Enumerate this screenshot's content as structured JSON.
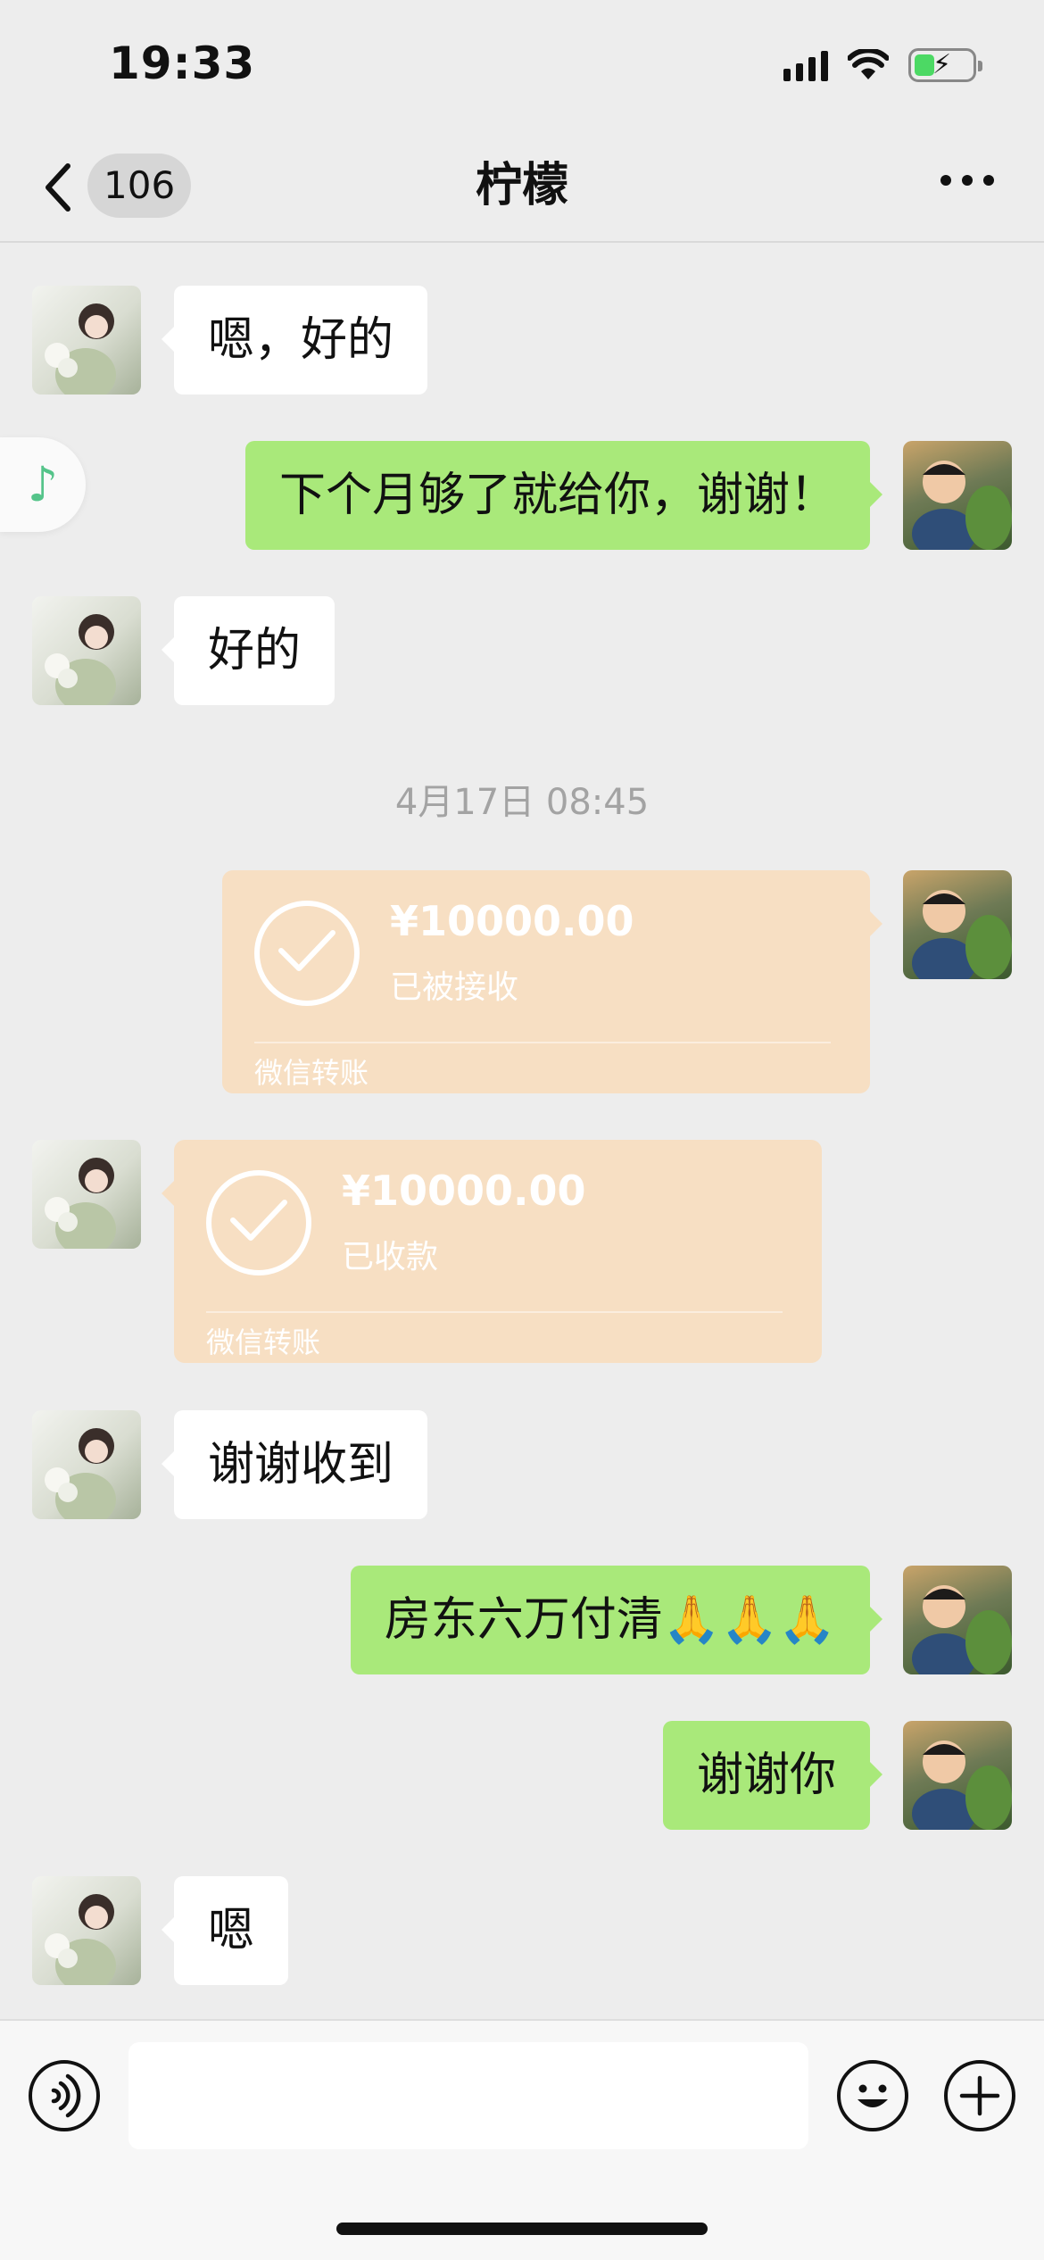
{
  "status_bar": {
    "time": "19:33"
  },
  "nav": {
    "unread_count": "106",
    "title": "柠檬"
  },
  "messages": {
    "m1": "嗯，好的",
    "m2": "下个月够了就给你，谢谢！",
    "m3": "好的",
    "timestamp": "4月17日 08:45",
    "transfer1": {
      "amount": "¥10000.00",
      "state": "已被接收",
      "footer": "微信转账"
    },
    "transfer2": {
      "amount": "¥10000.00",
      "state": "已收款",
      "footer": "微信转账"
    },
    "m4": "谢谢收到",
    "m5": "房东六万付清🙏🙏🙏",
    "m6": "谢谢你",
    "m7": "嗯"
  },
  "colors": {
    "background": "#ededed",
    "bubble_out": "#a9e97a",
    "bubble_in": "#ffffff",
    "transfer_card": "#f7dfc3"
  },
  "icons": {
    "back": "chevron-left-icon",
    "more": "more-icon",
    "voice": "voice-icon",
    "emoji": "emoji-icon",
    "add": "add-icon",
    "music": "music-note-icon"
  }
}
